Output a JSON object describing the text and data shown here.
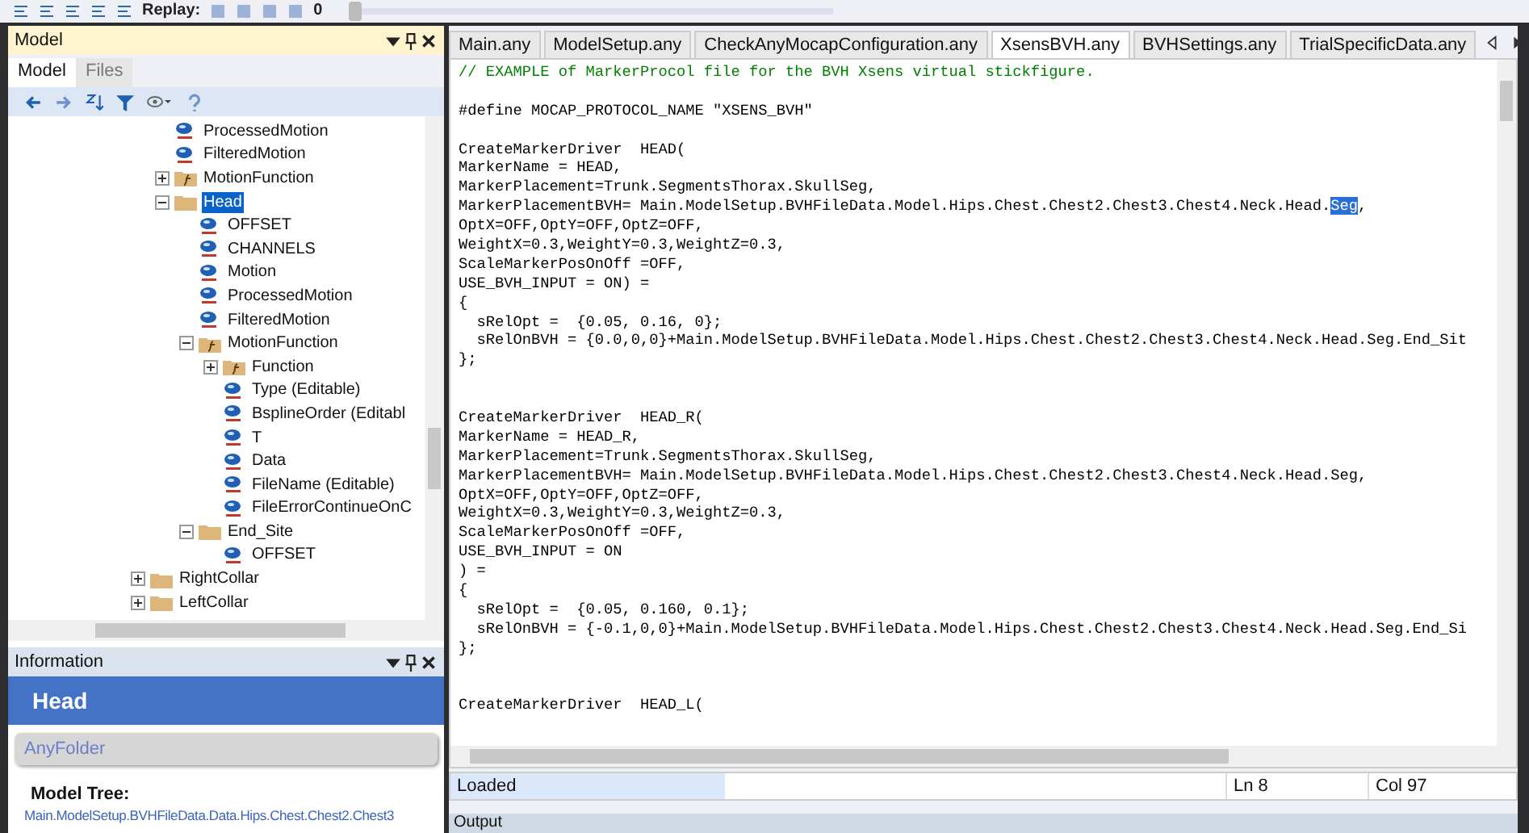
{
  "toolbar": {
    "replay_label": "Replay:",
    "frame": "0",
    "replay_slider": {
      "level": 0
    }
  },
  "model_panel": {
    "title": "Model",
    "tabs": [
      {
        "label": "Model",
        "selected": true
      },
      {
        "label": "Files",
        "selected": false
      }
    ],
    "tree": {
      "continued_children": [
        {
          "label": "ProcessedMotion",
          "kind": "value",
          "selected": false
        },
        {
          "label": "FilteredMotion",
          "kind": "value",
          "selected": false
        },
        {
          "label": "MotionFunction",
          "kind": "function",
          "expanded": false,
          "selected": false
        },
        {
          "label": "Head",
          "kind": "folder",
          "expanded": true,
          "selected": true,
          "children": [
            {
              "label": "OFFSET",
              "kind": "value",
              "selected": false
            },
            {
              "label": "CHANNELS",
              "kind": "value",
              "selected": false
            },
            {
              "label": "Motion",
              "kind": "value",
              "selected": false
            },
            {
              "label": "ProcessedMotion",
              "kind": "value",
              "selected": false
            },
            {
              "label": "FilteredMotion",
              "kind": "value",
              "selected": false
            },
            {
              "label": "MotionFunction",
              "kind": "function",
              "expanded": true,
              "selected": false,
              "children": [
                {
                  "label": "Function",
                  "kind": "function",
                  "expanded": false,
                  "selected": false
                },
                {
                  "label": "Type (Editable)",
                  "kind": "value",
                  "selected": false
                },
                {
                  "label": "BsplineOrder (Editabl",
                  "kind": "value",
                  "selected": false
                },
                {
                  "label": "T",
                  "kind": "value",
                  "selected": false
                },
                {
                  "label": "Data",
                  "kind": "value",
                  "selected": false
                },
                {
                  "label": "FileName (Editable)",
                  "kind": "value",
                  "selected": false
                },
                {
                  "label": "FileErrorContinueOnC",
                  "kind": "value",
                  "selected": false
                }
              ]
            },
            {
              "label": "End_Site",
              "kind": "folder",
              "expanded": true,
              "selected": false,
              "children": [
                {
                  "label": "OFFSET",
                  "kind": "value",
                  "selected": false
                }
              ]
            }
          ]
        }
      ],
      "items": [
        {
          "label": "RightCollar",
          "kind": "folder",
          "expanded": false,
          "selected": false
        },
        {
          "label": "LeftCollar",
          "kind": "folder",
          "expanded": false,
          "selected": false
        }
      ]
    }
  },
  "info_panel": {
    "title": "Information",
    "heading": "Head",
    "type": "AnyFolder",
    "tree_label": "Model Tree:",
    "tree_path": "Main.ModelSetup.BVHFileData.Data.Hips.Chest.Chest2.Chest3"
  },
  "editor": {
    "tabs": [
      {
        "label": "Main.any",
        "selected": false
      },
      {
        "label": "ModelSetup.any",
        "selected": false
      },
      {
        "label": "CheckAnyMocapConfiguration.any",
        "selected": false
      },
      {
        "label": "XsensBVH.any",
        "selected": true
      },
      {
        "label": "BVHSettings.any",
        "selected": false
      },
      {
        "label": "TrialSpecificData.any",
        "selected": false
      }
    ],
    "lines": [
      {
        "kind": "comment",
        "text": "// EXAMPLE of MarkerProcol file for the BVH Xsens virtual stickfigure."
      },
      {
        "kind": "blank"
      },
      {
        "kind": "code",
        "text": "#define MOCAP_PROTOCOL_NAME \"XSENS_BVH\""
      },
      {
        "kind": "blank"
      },
      {
        "kind": "code",
        "text": "CreateMarkerDriver  HEAD("
      },
      {
        "kind": "code",
        "text": "MarkerName = HEAD,"
      },
      {
        "kind": "code",
        "text": "MarkerPlacement=Trunk.SegmentsThorax.SkullSeg,"
      },
      {
        "kind": "selection",
        "before": "MarkerPlacementBVH= Main.ModelSetup.BVHFileData.Model.Hips.Chest.Chest2.Chest3.Chest4.Neck.Head.",
        "selected": "Seg",
        "after": ","
      },
      {
        "kind": "code",
        "text": "OptX=OFF,OptY=OFF,OptZ=OFF,"
      },
      {
        "kind": "code",
        "text": "WeightX=0.3,WeightY=0.3,WeightZ=0.3,"
      },
      {
        "kind": "code",
        "text": "ScaleMarkerPosOnOff =OFF,"
      },
      {
        "kind": "code",
        "text": "USE_BVH_INPUT = ON) ="
      },
      {
        "kind": "code",
        "text": "{"
      },
      {
        "kind": "code",
        "text": "  sRelOpt =  {0.05, 0.16, 0};"
      },
      {
        "kind": "code",
        "text": "  sRelOnBVH = {0.0,0,0}+Main.ModelSetup.BVHFileData.Model.Hips.Chest.Chest2.Chest3.Chest4.Neck.Head.Seg.End_Sit"
      },
      {
        "kind": "code",
        "text": "};"
      },
      {
        "kind": "blank"
      },
      {
        "kind": "blank"
      },
      {
        "kind": "code",
        "text": "CreateMarkerDriver  HEAD_R("
      },
      {
        "kind": "code",
        "text": "MarkerName = HEAD_R,"
      },
      {
        "kind": "code",
        "text": "MarkerPlacement=Trunk.SegmentsThorax.SkullSeg,"
      },
      {
        "kind": "code",
        "text": "MarkerPlacementBVH= Main.ModelSetup.BVHFileData.Model.Hips.Chest.Chest2.Chest3.Chest4.Neck.Head.Seg,"
      },
      {
        "kind": "code",
        "text": "OptX=OFF,OptY=OFF,OptZ=OFF,"
      },
      {
        "kind": "code",
        "text": "WeightX=0.3,WeightY=0.3,WeightZ=0.3,"
      },
      {
        "kind": "code",
        "text": "ScaleMarkerPosOnOff =OFF,"
      },
      {
        "kind": "code",
        "text": "USE_BVH_INPUT = ON"
      },
      {
        "kind": "code",
        "text": ") ="
      },
      {
        "kind": "code",
        "text": "{"
      },
      {
        "kind": "code",
        "text": "  sRelOpt =  {0.05, 0.160, 0.1};"
      },
      {
        "kind": "code",
        "text": "  sRelOnBVH = {-0.1,0,0}+Main.ModelSetup.BVHFileData.Model.Hips.Chest.Chest2.Chest3.Chest4.Neck.Head.Seg.End_Si"
      },
      {
        "kind": "code",
        "text": "};"
      },
      {
        "kind": "blank"
      },
      {
        "kind": "blank"
      },
      {
        "kind": "code",
        "text": "CreateMarkerDriver  HEAD_L("
      }
    ]
  },
  "status_bar": {
    "status": "Loaded",
    "line": "Ln 8",
    "column": "Col 97"
  },
  "output_panel": {
    "title": "Output"
  }
}
